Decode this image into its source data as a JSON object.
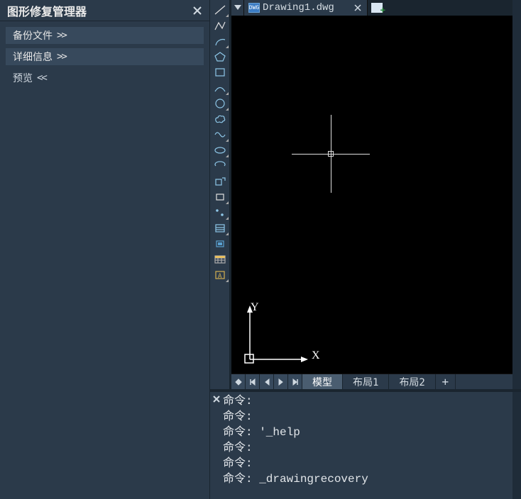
{
  "sidebar": {
    "title": "图形修复管理器",
    "items": [
      {
        "label": "备份文件",
        "chevron": ">>"
      },
      {
        "label": "详细信息",
        "chevron": ">>"
      },
      {
        "label": "预览",
        "chevron": "<<"
      }
    ]
  },
  "file_tab": {
    "label": "Drawing1.dwg",
    "icon_text": "DWG"
  },
  "ucs": {
    "x": "X",
    "y": "Y"
  },
  "bottom_tabs": {
    "model": "模型",
    "layout1": "布局1",
    "layout2": "布局2",
    "plus": "+"
  },
  "command_log": [
    "命令: ",
    "命令: ",
    "命令: '_help",
    "命令: ",
    "命令: ",
    "命令: _drawingrecovery"
  ]
}
